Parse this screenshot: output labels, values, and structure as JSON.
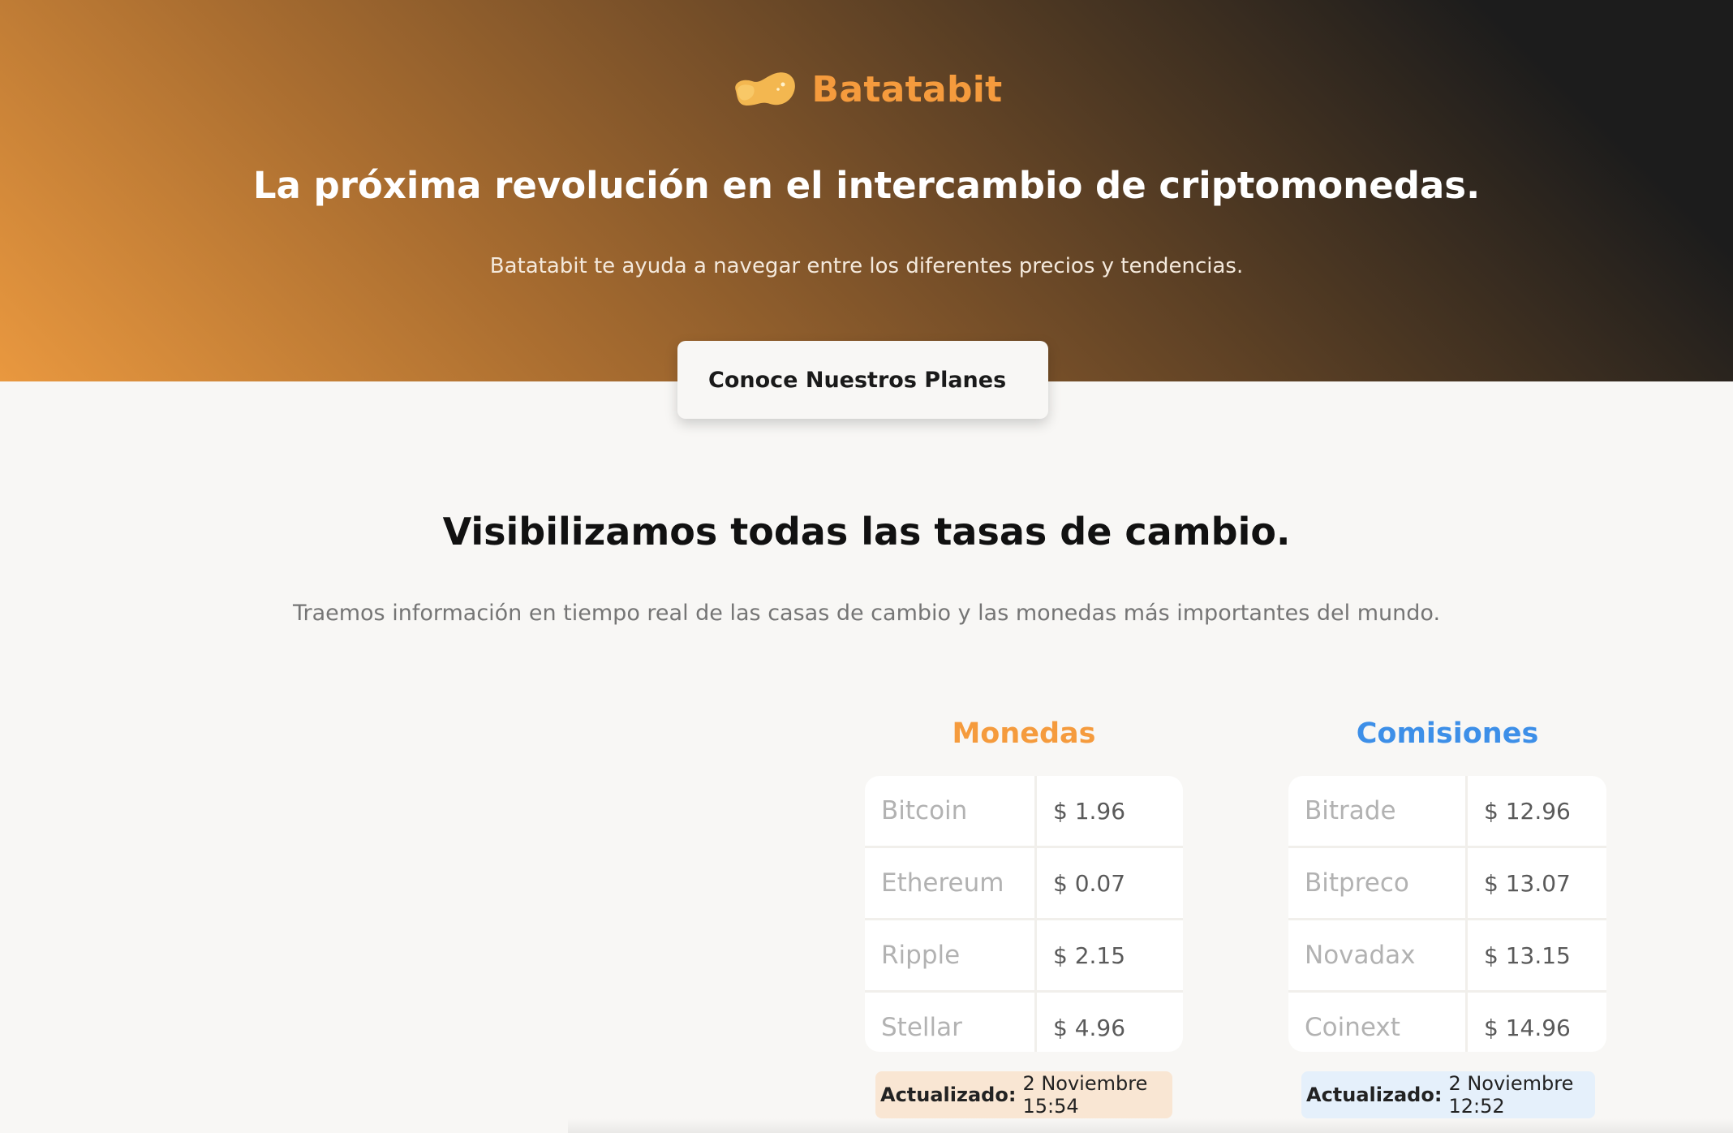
{
  "colors": {
    "accent_orange": "#f59b3d",
    "accent_blue": "#3d8fe8",
    "hero_dark": "#1c1c1c",
    "hero_light": "#e9983f"
  },
  "header": {
    "logo_icon": "potato-icon",
    "brand": "Batatabit",
    "title": "La próxima revolución en el intercambio de criptomonedas.",
    "subtitle": "Batatabit te ayuda a navegar entre los diferentes precios y tendencias.",
    "cta_label": "Conoce Nuestros Planes"
  },
  "main": {
    "title": "Visibilizamos todas las tasas de cambio.",
    "subtitle": "Traemos información en tiempo real de las casas de cambio y las monedas más importantes del mundo."
  },
  "tables": {
    "coins": {
      "title": "Monedas",
      "rows": [
        {
          "name": "Bitcoin",
          "value": "$ 1.96"
        },
        {
          "name": "Ethereum",
          "value": "$ 0.07"
        },
        {
          "name": "Ripple",
          "value": "$ 2.15"
        },
        {
          "name": "Stellar",
          "value": "$ 4.96"
        }
      ],
      "updated_label": "Actualizado:",
      "updated_value": "2 Noviembre 15:54"
    },
    "fees": {
      "title": "Comisiones",
      "rows": [
        {
          "name": "Bitrade",
          "value": "$ 12.96"
        },
        {
          "name": "Bitpreco",
          "value": "$ 13.07"
        },
        {
          "name": "Novadax",
          "value": "$ 13.15"
        },
        {
          "name": "Coinext",
          "value": "$ 14.96"
        }
      ],
      "updated_label": "Actualizado:",
      "updated_value": "2 Noviembre 12:52"
    }
  }
}
